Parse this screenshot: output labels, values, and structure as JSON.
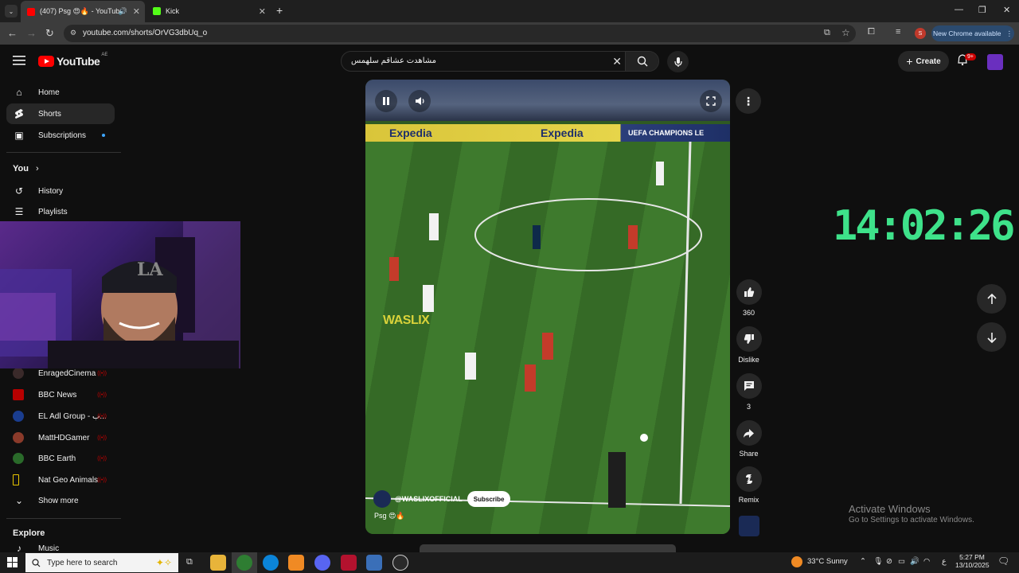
{
  "browser": {
    "tabs": [
      {
        "title": "(407) Psg 😍🔥 - YouTube",
        "active": true
      },
      {
        "title": "Kick",
        "active": false
      }
    ],
    "url": "youtube.com/shorts/OrVG3dbUq_o",
    "new_chrome_label": "New Chrome available",
    "profile_letter": "S"
  },
  "youtube": {
    "logo_word": "YouTube",
    "region": "AE",
    "search_value": "مشاهدت عشاقم سلهمس",
    "create_label": "Create",
    "notif_count": "9+"
  },
  "sidebar": {
    "main": [
      {
        "label": "Home",
        "icon": "home-icon"
      },
      {
        "label": "Shorts",
        "icon": "shorts-icon",
        "active": true
      },
      {
        "label": "Subscriptions",
        "icon": "subscriptions-icon"
      }
    ],
    "you_label": "You",
    "you_items": [
      {
        "label": "History",
        "icon": "history-icon"
      },
      {
        "label": "Playlists",
        "icon": "playlists-icon"
      }
    ],
    "channels": [
      {
        "label": "EnragedCinema",
        "color": "#3a2a2a"
      },
      {
        "label": "BBC News",
        "color": "#b80000"
      },
      {
        "label": "EL Adl Group - ب...",
        "color": "#1a3d8f"
      },
      {
        "label": "MattHDGamer",
        "color": "#8a3a2a"
      },
      {
        "label": "BBC Earth",
        "color": "#2a6a2a"
      },
      {
        "label": "Nat Geo Animals",
        "color": "#111111"
      }
    ],
    "show_more": "Show more",
    "explore_label": "Explore",
    "explore_first": "Music"
  },
  "video": {
    "channel": "@WASLIXOFFICIAL",
    "subscribe_label": "Subscribe",
    "caption": "Psg 😍🔥",
    "watermark": "WASLIX",
    "ad1": "Expedia",
    "ad2": "Expedia",
    "ad3": "UEFA CHAMPIONS LE"
  },
  "actions": {
    "likes": "360",
    "dislike_label": "Dislike",
    "comments": "3",
    "share_label": "Share",
    "remix_label": "Remix"
  },
  "overlay": {
    "clock": "14:02:26",
    "activate_title": "Activate Windows",
    "activate_sub": "Go to Settings to activate Windows."
  },
  "taskbar": {
    "search_placeholder": "Type here to search",
    "weather": "33°C  Sunny",
    "time": "5:27 PM",
    "date": "13/10/2025",
    "lang": "ع"
  }
}
